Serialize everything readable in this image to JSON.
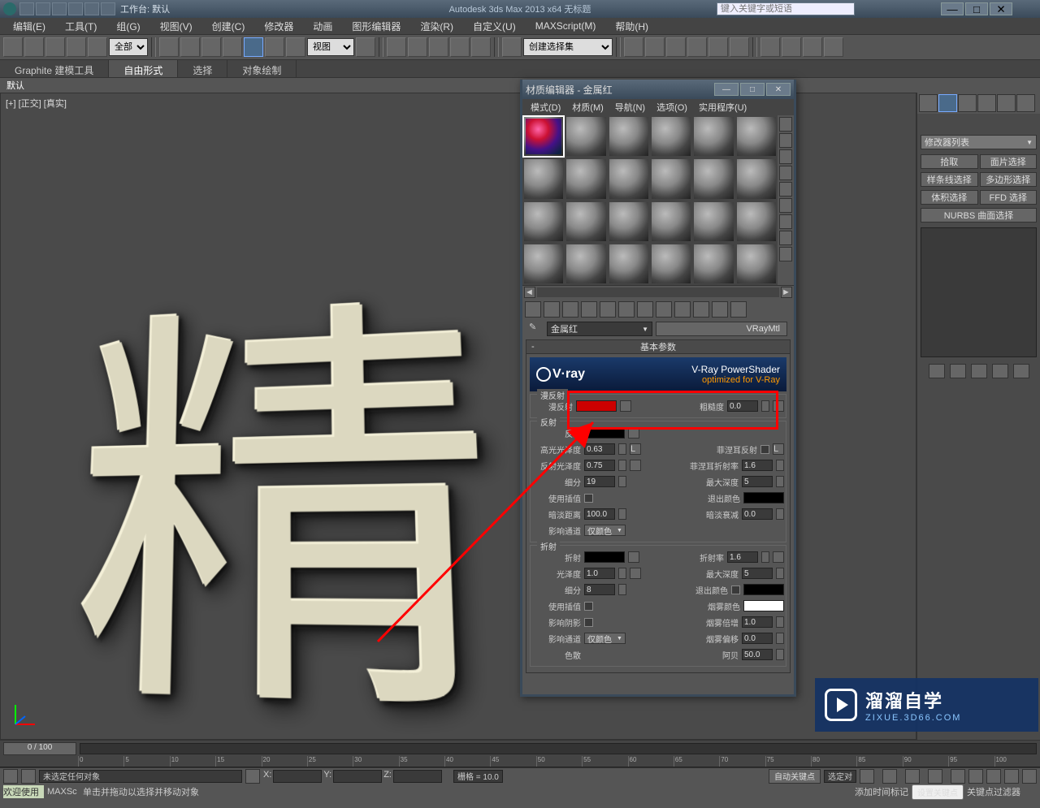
{
  "titlebar": {
    "workspace_label": "工作台: 默认",
    "app_title": "Autodesk 3ds Max  2013 x64    无标题",
    "search_placeholder": "键入关键字或短语"
  },
  "menus": [
    "编辑(E)",
    "工具(T)",
    "组(G)",
    "视图(V)",
    "创建(C)",
    "修改器",
    "动画",
    "图形编辑器",
    "渲染(R)",
    "自定义(U)",
    "MAXScript(M)",
    "帮助(H)"
  ],
  "toolbar": {
    "selection_filter": "全部",
    "view_mode": "视图",
    "named_set": "创建选择集"
  },
  "ribbon": {
    "tabs": [
      "Graphite 建模工具",
      "自由形式",
      "选择",
      "对象绘制"
    ],
    "sub": "默认"
  },
  "viewport": {
    "label": "[+] [正交] [真实]",
    "glyph": "精"
  },
  "cmdpanel": {
    "ddl": "修改器列表",
    "row1": [
      "拾取",
      "面片选择"
    ],
    "row2": [
      "样条线选择",
      "多边形选择"
    ],
    "row3": [
      "体积选择",
      "FFD 选择"
    ],
    "row4": [
      "NURBS 曲面选择"
    ]
  },
  "matedit": {
    "title": "材质编辑器 - 金属红",
    "menus": [
      "模式(D)",
      "材质(M)",
      "导航(N)",
      "选项(O)",
      "实用程序(U)"
    ],
    "mat_name": "金属红",
    "mat_type": "VRayMtl",
    "rollout_basic": "基本参数",
    "vray": {
      "logo": "V·ray",
      "line1": "V-Ray PowerShader",
      "line2": "optimized for V-Ray"
    },
    "groups": {
      "diffuse": {
        "label": "漫反射",
        "diffuse": "漫反射",
        "rough": "粗糙度",
        "rough_val": "0.0"
      },
      "reflect": {
        "label": "反射",
        "reflect": "反射",
        "hglossy": "高光光泽度",
        "hglossy_val": "0.63",
        "rglossy": "反射光泽度",
        "rglossy_val": "0.75",
        "subdivs": "细分",
        "subdivs_val": "19",
        "useinterp": "使用插值",
        "dimdist": "暗淡距离",
        "dimdist_val": "100.0",
        "affect": "影响通道",
        "affect_val": "仅颜色",
        "fresnel": "菲涅耳反射",
        "fresnel_ior": "菲涅耳折射率",
        "fresnel_ior_val": "1.6",
        "maxdepth": "最大深度",
        "maxdepth_val": "5",
        "exitcolor": "退出颜色",
        "dimfall": "暗淡衰减",
        "dimfall_val": "0.0"
      },
      "refract": {
        "label": "折射",
        "refract": "折射",
        "glossy": "光泽度",
        "glossy_val": "1.0",
        "subdivs": "细分",
        "subdivs_val": "8",
        "useinterp": "使用插值",
        "affectshadow": "影响阴影",
        "affect": "影响通道",
        "affect_val": "仅颜色",
        "ior": "折射率",
        "ior_val": "1.6",
        "maxdepth": "最大深度",
        "maxdepth_val": "5",
        "exitcolor": "退出颜色",
        "fogcolor": "烟雾颜色",
        "fogmult": "烟雾倍增",
        "fogmult_val": "1.0",
        "fogbias": "烟雾偏移",
        "fogbias_val": "0.0",
        "total": "色散",
        "abbe": "阿贝",
        "abbe_val": "50.0"
      }
    }
  },
  "timeline": {
    "slider_label": "0 / 100",
    "ticks": [
      "0",
      "5",
      "10",
      "15",
      "20",
      "25",
      "30",
      "35",
      "40",
      "45",
      "50",
      "55",
      "60",
      "65",
      "70",
      "75",
      "80",
      "85",
      "90",
      "95",
      "100"
    ]
  },
  "status": {
    "info1": "未选定任何对象",
    "info2": "单击并拖动以选择并移动对象",
    "x": "X:",
    "y": "Y:",
    "z": "Z:",
    "grid": "栅格 = 10.0",
    "autokey": "自动关键点",
    "selected_only": "选定对",
    "addmarker": "添加时间标记",
    "setkey": "设置关键点",
    "keyfilter": "关键点过滤器",
    "welcome": "欢迎使用",
    "maxsc": "MAXSc"
  },
  "watermark": {
    "line1": "溜溜自学",
    "line2": "ZIXUE.3D66.COM"
  }
}
